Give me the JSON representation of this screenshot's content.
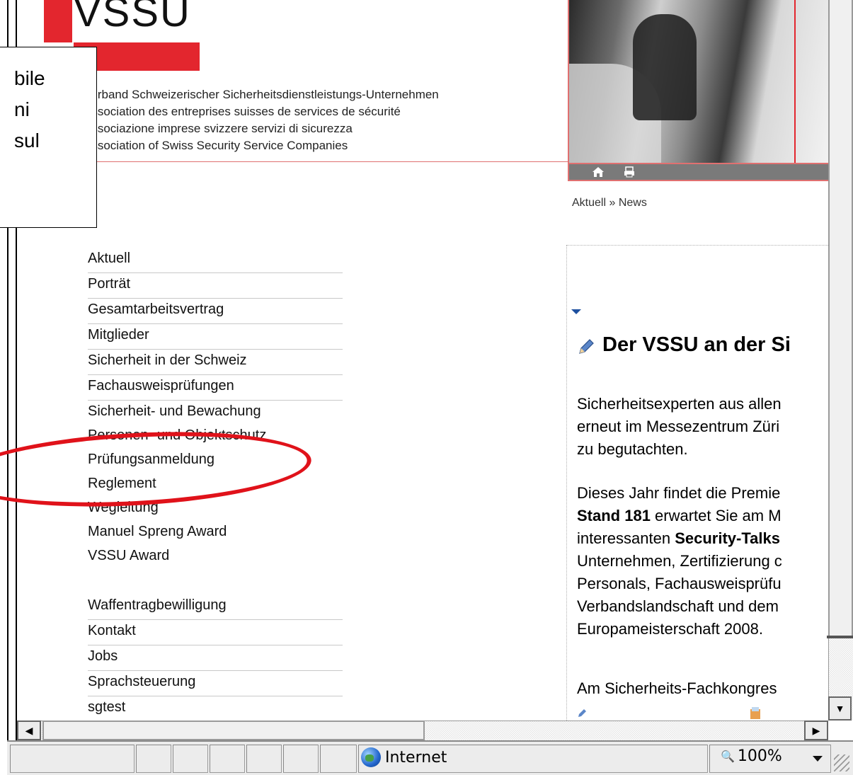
{
  "logo": {
    "text": "VSSU"
  },
  "association_names": [
    "Verband Schweizerischer Sicherheitsdienstleistungs-Unternehmen",
    "Association des entreprises suisses de services de sécurité",
    "Associazione imprese svizzere servizi di sicurezza",
    "Association of Swiss Security Service Companies"
  ],
  "header_icons": [
    "home-icon",
    "print-icon"
  ],
  "breadcrumb": "Aktuell » News",
  "callout": {
    "lines": [
      "bile",
      "ni",
      "sul"
    ]
  },
  "nav_main": [
    "Aktuell",
    "Porträt",
    "Gesamtarbeitsvertrag",
    "Mitglieder",
    "Sicherheit in der Schweiz",
    "Fachausweisprüfungen",
    "Sicherheit- und Bewachung",
    "Personen- und Objektschutz",
    "Prüfungsanmeldung",
    "Reglement",
    "Wegleitung",
    "Manuel Spreng Award",
    "VSSU Award"
  ],
  "nav_second": [
    "Waffentragbewilligung",
    "Kontakt",
    "Jobs",
    "Sprachsteuerung",
    "sgtest"
  ],
  "highlight": {
    "color": "#e0121a"
  },
  "article": {
    "title": "Der VSSU an der Si",
    "para1": [
      "Sicherheitsexperten aus allen",
      "erneut im Messezentrum Züri",
      "zu begutachten."
    ],
    "para2": {
      "line1": "Dieses Jahr findet die Premie",
      "line2_bold": "Stand 181",
      "line2_rest": " erwartet Sie am M",
      "line3_start": "interessanten ",
      "line3_bold": "Security-Talks",
      "line4": "Unternehmen, Zertifizierung c",
      "line5": "Personals, Fachausweisprüfu",
      "line6": "Verbandslandschaft und dem",
      "line7": "Europameisterschaft 2008."
    },
    "para3": "Am Sicherheits-Fachkongres"
  },
  "statusbar": {
    "zone": "Internet",
    "zoom": "100%"
  },
  "colors": {
    "brand_red": "#e3262e",
    "link_blue": "#1e50a0"
  }
}
